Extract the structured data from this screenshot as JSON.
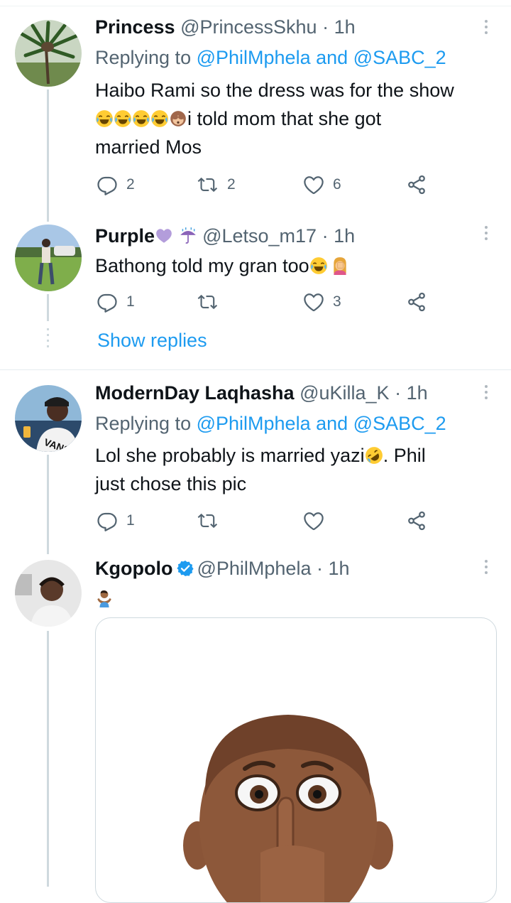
{
  "tweets": [
    {
      "name": "Princess",
      "handle": "@PrincessSkhu",
      "sep": "·",
      "time": "1h",
      "replying_prefix": "Replying to ",
      "reply_mention_1": "@PhilMphela",
      "reply_and": " and ",
      "reply_mention_2": "@SABC_2",
      "text_line1": "Haibo Rami so the dress was for the show",
      "text_line2": "i told mom that she got",
      "text_line3": "married Mos",
      "replies": "2",
      "retweets": "2",
      "likes": "6"
    },
    {
      "name": "Purple",
      "handle": "@Letso_m17",
      "sep": "·",
      "time": "1h",
      "text": "Bathong told my gran too",
      "replies": "1",
      "retweets": "",
      "likes": "3"
    },
    {
      "name": "ModernDay Laqhasha",
      "handle": "@uKilla_K",
      "sep": "·",
      "time": "1h",
      "replying_prefix": "Replying to ",
      "reply_mention_1": "@PhilMphela",
      "reply_and": " and ",
      "reply_mention_2": "@SABC_2",
      "text_line1a": "Lol she probably is married yazi",
      "text_line1b": ". Phil",
      "text_line2": "just chose this pic",
      "replies": "1",
      "retweets": "",
      "likes": ""
    },
    {
      "name": "Kgopolo",
      "handle": "@PhilMphela",
      "sep": "·",
      "time": "1h"
    }
  ],
  "show_replies": "Show replies",
  "colors": {
    "link": "#1d9bf0",
    "secondary_text": "#536471",
    "primary_text": "#0f1419",
    "thread_line": "#cfd9de",
    "verified": "#1d9bf0",
    "heart_emoji": "#b39ddb"
  },
  "icons": [
    "reply-icon",
    "retweet-icon",
    "like-icon",
    "share-icon",
    "more-icon",
    "verified-icon"
  ]
}
